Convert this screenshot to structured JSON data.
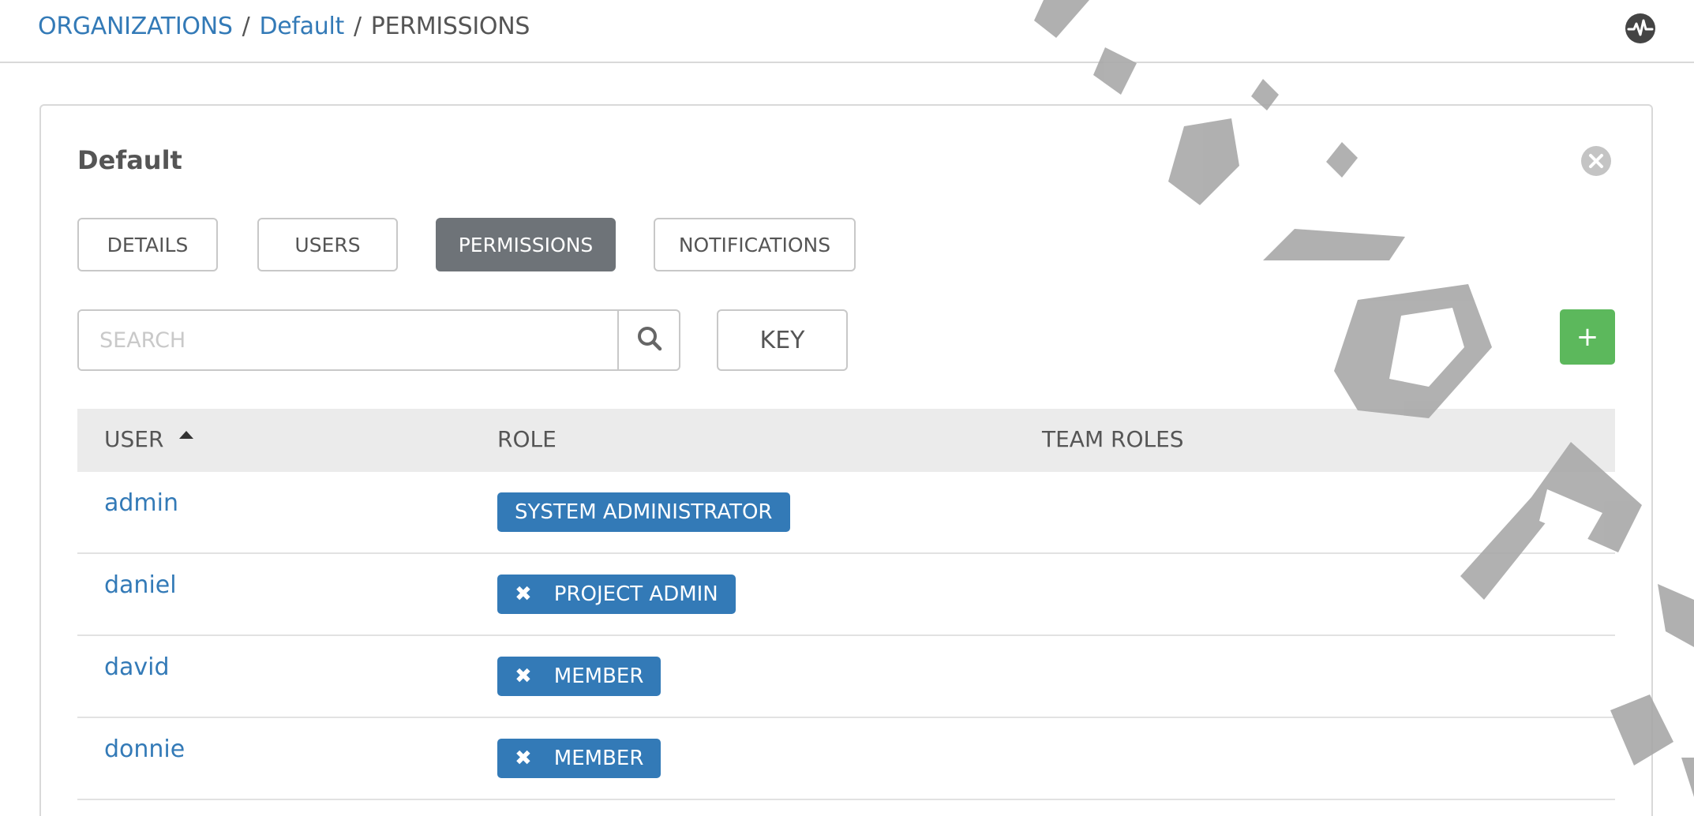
{
  "breadcrumb": {
    "organizations": "ORGANIZATIONS",
    "separator": "/",
    "org_name": "Default",
    "current": "PERMISSIONS"
  },
  "panel": {
    "title": "Default"
  },
  "tabs": [
    {
      "label": "DETAILS",
      "active": false
    },
    {
      "label": "USERS",
      "active": false
    },
    {
      "label": "PERMISSIONS",
      "active": true
    },
    {
      "label": "NOTIFICATIONS",
      "active": false
    }
  ],
  "search": {
    "placeholder": "SEARCH",
    "value": ""
  },
  "key_label": "KEY",
  "add_label": "+",
  "table": {
    "columns": [
      "USER",
      "ROLE",
      "TEAM ROLES"
    ],
    "rows": [
      {
        "user": "admin",
        "role": "SYSTEM ADMINISTRATOR",
        "removable": false
      },
      {
        "user": "daniel",
        "role": "PROJECT ADMIN",
        "removable": true
      },
      {
        "user": "david",
        "role": "MEMBER",
        "removable": true
      },
      {
        "user": "donnie",
        "role": "MEMBER",
        "removable": true
      }
    ]
  },
  "remove_symbol": "✖",
  "colors": {
    "link": "#337ab7",
    "badge": "#337ab7",
    "active_tab": "#6e7378",
    "add_button": "#5cb85c",
    "header_bg": "#ebebeb"
  },
  "icons": {
    "activity": "activity-stream-icon",
    "close": "close-circle-icon",
    "search": "search-icon",
    "sort": "sort-ascending-icon",
    "remove": "remove-x-icon"
  }
}
